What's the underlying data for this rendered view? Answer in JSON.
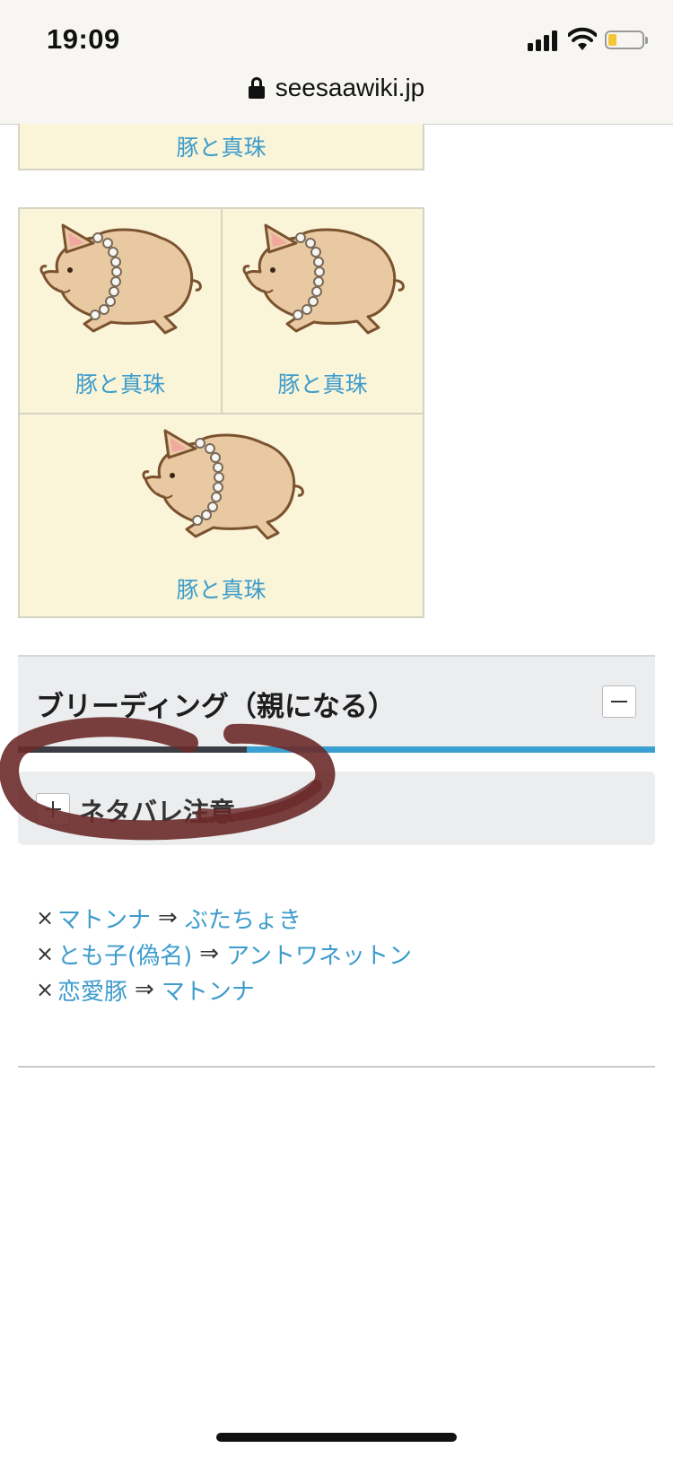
{
  "status_bar": {
    "time": "19:09"
  },
  "url_bar": {
    "domain": "seesaawiki.jp"
  },
  "gallery": {
    "top_caption": "豚と真珠",
    "items": [
      {
        "caption": "豚と真珠",
        "image": "pig-with-pearls"
      },
      {
        "caption": "豚と真珠",
        "image": "pig-with-pearls"
      },
      {
        "caption": "豚と真珠",
        "image": "pig-with-pearls"
      }
    ]
  },
  "section": {
    "title": "ブリーディング（親になる）",
    "collapse_symbol": "−"
  },
  "spoiler": {
    "label": "ネタバレ注意",
    "expand_symbol": "+"
  },
  "breeding": {
    "mark": "×",
    "arrow": "⇒",
    "rows": [
      {
        "parent": "マトンナ",
        "child": "ぶたちょき"
      },
      {
        "parent": "とも子(偽名)",
        "child": "アントワネットン"
      },
      {
        "parent": "恋愛豚",
        "child": "マトンナ"
      }
    ]
  },
  "colors": {
    "link": "#3d9ccc",
    "cell_bg": "#faf5d8",
    "section_bar": "#3a9fd1",
    "marker": "#6b2a2a"
  }
}
